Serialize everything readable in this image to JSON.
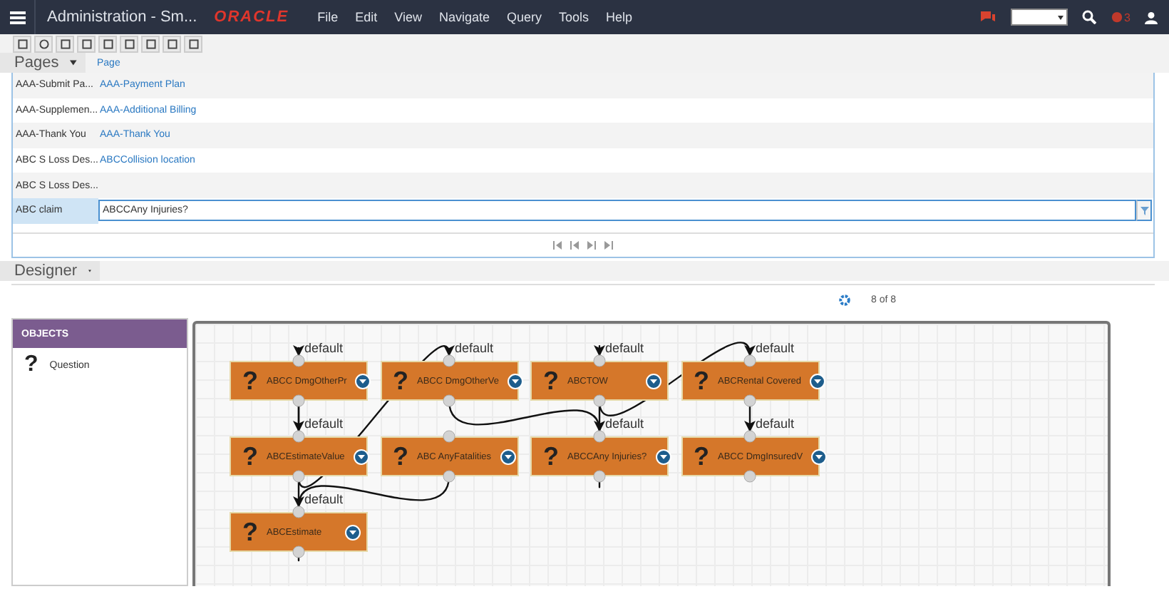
{
  "top_bar": {
    "title": "Administration - Sm...",
    "logo": "ORACLE",
    "menu": [
      "File",
      "Edit",
      "View",
      "Navigate",
      "Query",
      "Tools",
      "Help"
    ],
    "notification_count": "3"
  },
  "pages": {
    "title": "Pages",
    "column": "Page",
    "rows": [
      {
        "name": "AAA-Submit Pa...",
        "page": "AAA-Payment Plan",
        "selected": false
      },
      {
        "name": "AAA-Supplemen...",
        "page": "AAA-Additional Billing",
        "selected": false
      },
      {
        "name": "AAA-Thank You",
        "page": "AAA-Thank You",
        "selected": false
      },
      {
        "name": "ABC S Loss Des...",
        "page": "ABCCollision location",
        "selected": false
      },
      {
        "name": "ABC S Loss Des...",
        "selected": false
      },
      {
        "name": "ABC claim",
        "page": "ABCCAny Injuries?",
        "selected": true
      }
    ]
  },
  "designer": {
    "title": "Designer",
    "count": "8 of 8",
    "objects_title": "OBJECTS",
    "objects": [
      {
        "icon": "?",
        "label": "Question"
      }
    ],
    "node_rows": [
      [
        {
          "icon": "?",
          "label": "ABCC DmgOtherPr"
        },
        {
          "icon": "?",
          "label": "ABCC DmgOtherVe"
        },
        {
          "icon": "?",
          "label": "ABCTOW"
        },
        {
          "icon": "?",
          "label": "ABCRental Covered"
        }
      ],
      [
        {
          "icon": "?",
          "label": "ABCEstimateValue"
        },
        {
          "icon": "?",
          "label": "ABC AnyFatalities"
        },
        {
          "icon": "?",
          "label": "ABCCAny Injuries?"
        },
        {
          "icon": "?",
          "label": "ABCC DmgInsuredV"
        }
      ],
      [
        {
          "icon": "?",
          "label": "ABCEstimate"
        }
      ]
    ],
    "edges": [
      {
        "label": "default"
      },
      {
        "label": "default"
      },
      {
        "label": "default"
      },
      {
        "label": "default"
      },
      {
        "label": "default"
      },
      {
        "label": "default"
      },
      {
        "label": "default"
      },
      {
        "label": "default"
      }
    ]
  }
}
